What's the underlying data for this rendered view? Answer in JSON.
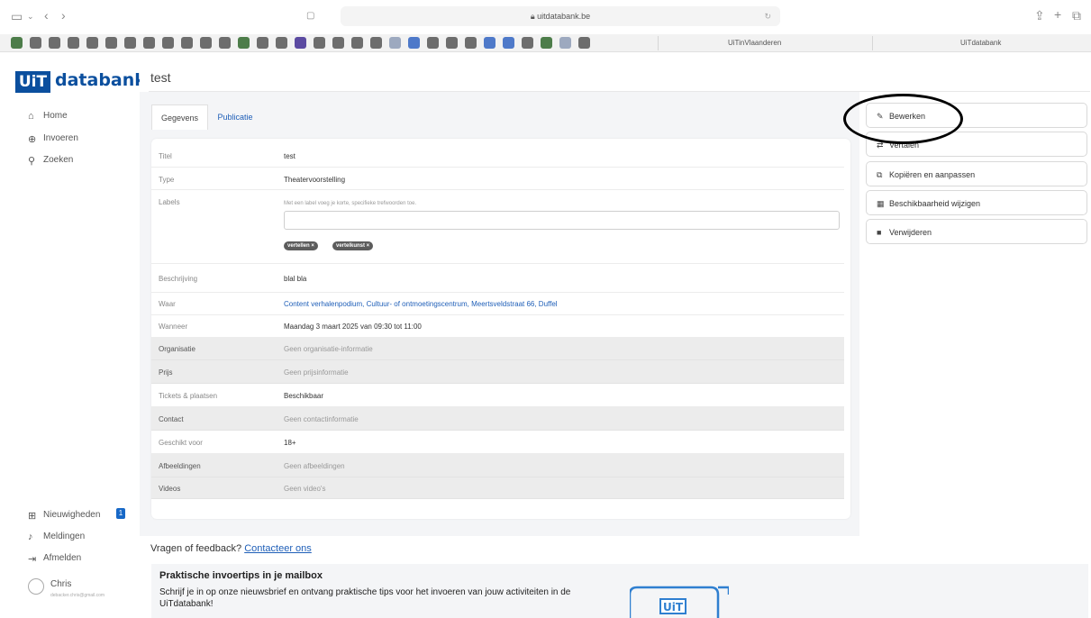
{
  "browser": {
    "url": "uitdatabank.be",
    "tabs": [
      "UiTinVlaanderen",
      "UiTdatabank"
    ]
  },
  "sidebar": {
    "logo_box": "UiT",
    "logo_text": "databank",
    "nav": [
      {
        "label": "Home",
        "icon": "home-icon"
      },
      {
        "label": "Invoeren",
        "icon": "plus-circle-icon"
      },
      {
        "label": "Zoeken",
        "icon": "search-icon"
      }
    ],
    "bottom": [
      {
        "label": "Nieuwigheden",
        "icon": "gift-icon"
      },
      {
        "label": "Meldingen",
        "icon": "bell-icon"
      },
      {
        "label": "Afmelden",
        "icon": "logout-icon"
      }
    ],
    "badge": "1",
    "user_name": "Chris",
    "user_email": "debacker.chris@gmail.com"
  },
  "page": {
    "title": "test",
    "tabs": [
      "Gegevens",
      "Publicatie"
    ]
  },
  "details": [
    {
      "key": "Titel",
      "value": "test"
    },
    {
      "key": "Type",
      "value": "Theatervoorstelling"
    },
    {
      "key": "Labels",
      "hint": "Met een label voeg je korte, specifieke trefwoorden toe.",
      "chips": [
        "vertellen ×",
        "vertelkunst ×"
      ]
    },
    {
      "key": "Beschrijving",
      "value": "blal bla"
    },
    {
      "key": "Waar",
      "value": "Content verhalenpodium, Cultuur- of ontmoetingscentrum, Meertsveldstraat 66, Duffel"
    },
    {
      "key": "Wanneer",
      "value": "Maandag 3 maart 2025 van 09:30 tot 11:00"
    },
    {
      "key": "Organisatie",
      "value": "Geen organisatie-informatie"
    },
    {
      "key": "Prijs",
      "value": "Geen prijsinformatie"
    },
    {
      "key": "Tickets & plaatsen",
      "value": "Beschikbaar"
    },
    {
      "key": "Contact",
      "value": "Geen contactinformatie"
    },
    {
      "key": "Geschikt voor",
      "value": "18+"
    },
    {
      "key": "Afbeeldingen",
      "value": "Geen afbeeldingen"
    },
    {
      "key": "Videos",
      "value": "Geen video's"
    }
  ],
  "actions": [
    {
      "label": "Bewerken",
      "icon": "pencil-icon"
    },
    {
      "label": "Vertalen",
      "icon": "translate-icon"
    },
    {
      "label": "Kopiëren en aanpassen",
      "icon": "copy-icon"
    },
    {
      "label": "Beschikbaarheid wijzigen",
      "icon": "calendar-icon"
    },
    {
      "label": "Verwijderen",
      "icon": "trash-icon"
    }
  ],
  "feedback": {
    "text": "Vragen of feedback?",
    "link": "Contacteer ons"
  },
  "promo": {
    "title": "Praktische invoertips in je mailbox",
    "text": "Schrijf je in op onze nieuwsbrief en ontvang praktische tips voor het invoeren van jouw activiteiten in de UiTdatabank!",
    "logo": "UiT"
  },
  "colors": {
    "brand": "#0b4f9e",
    "link": "#1f5fb8",
    "badge": "#1768c7"
  }
}
